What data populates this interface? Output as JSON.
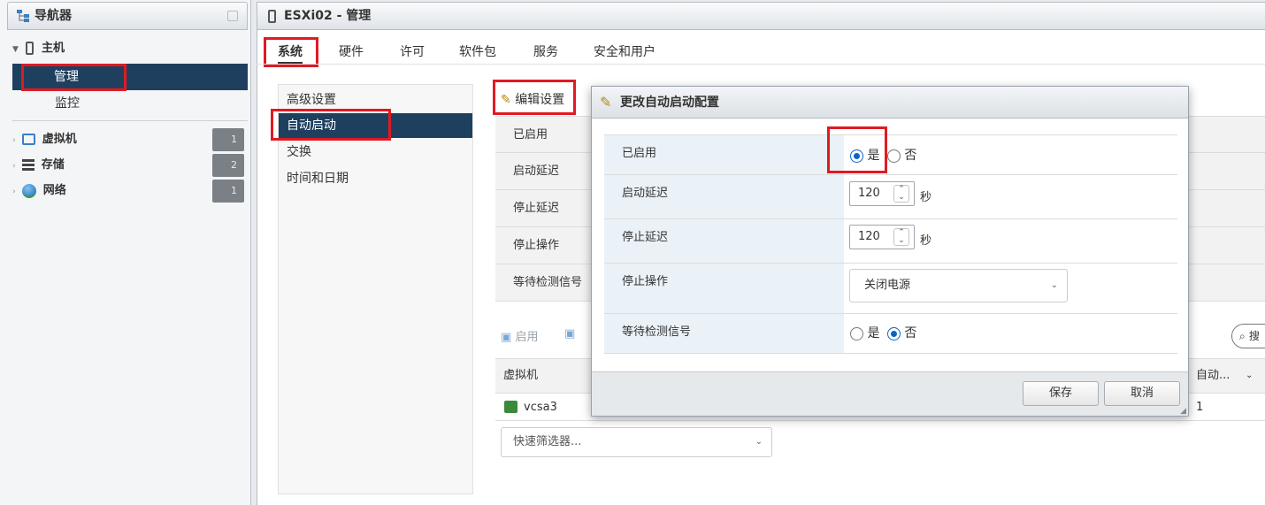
{
  "navigator": {
    "title": "导航器",
    "host": "主机",
    "manage": "管理",
    "monitor": "监控",
    "items": [
      {
        "label": "虚拟机",
        "count": "1"
      },
      {
        "label": "存储",
        "count": "2"
      },
      {
        "label": "网络",
        "count": "1"
      }
    ]
  },
  "main": {
    "title": "ESXi02 - 管理",
    "tabs": [
      "系统",
      "硬件",
      "许可",
      "软件包",
      "服务",
      "安全和用户"
    ],
    "settings": [
      "高级设置",
      "自动启动",
      "交换",
      "时间和日期"
    ],
    "edit_settings": "编辑设置",
    "props": [
      "已启用",
      "启动延迟",
      "停止延迟",
      "停止操作",
      "等待检测信号"
    ],
    "toolbar_enable": "启用",
    "vm_column": "虚拟机",
    "autostart_column": "自动...",
    "vm_name": "vcsa3",
    "vm_order": "1",
    "quick_filter": "快速筛选器...",
    "search_partial": "搜"
  },
  "modal": {
    "title": "更改自动启动配置",
    "rows": {
      "enabled": {
        "label": "已启用",
        "yes": "是",
        "no": "否",
        "selected": "yes"
      },
      "start_delay": {
        "label": "启动延迟",
        "value": "120",
        "unit": "秒"
      },
      "stop_delay": {
        "label": "停止延迟",
        "value": "120",
        "unit": "秒"
      },
      "stop_action": {
        "label": "停止操作",
        "value": "关闭电源"
      },
      "wait_heartbeat": {
        "label": "等待检测信号",
        "yes": "是",
        "no": "否",
        "selected": "no"
      }
    },
    "save": "保存",
    "cancel": "取消"
  }
}
